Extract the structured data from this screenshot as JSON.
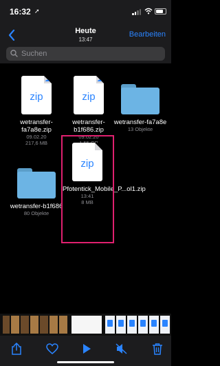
{
  "status_bar": {
    "time": "16:32",
    "location_glyph": "➚"
  },
  "nav": {
    "title": "Heute",
    "subtitle": "13:47",
    "edit_label": "Bearbeiten"
  },
  "search": {
    "placeholder": "Suchen"
  },
  "files": [
    {
      "type": "zip",
      "icon_label": "zip",
      "name": "wetransfer-fa7a8e.zip",
      "date": "09.02.20",
      "size": "217,6 MB",
      "cloud": true
    },
    {
      "type": "zip",
      "icon_label": "zip",
      "name": "wetransfer-b1f686.zip",
      "date": "09.02.20",
      "size": "1,55 GB",
      "cloud": true
    },
    {
      "type": "folder",
      "name": "wetransfer-fa7a8e",
      "detail": "13 Objekte"
    },
    {
      "type": "folder",
      "name": "wetransfer-b1f686",
      "detail": "80 Objekte"
    },
    {
      "type": "zip",
      "icon_label": "zip",
      "name": "Pfotentick_Mobile_P...ol1.zip",
      "date": "13:41",
      "size": "8 MB",
      "cloud": false,
      "highlighted": true
    }
  ],
  "colors": {
    "accent": "#2a84ff",
    "highlight": "#e0206f",
    "folder": "#6cb4e4"
  },
  "toolbar": [
    "share-icon",
    "heart-icon",
    "play-icon",
    "mute-icon",
    "trash-icon"
  ]
}
